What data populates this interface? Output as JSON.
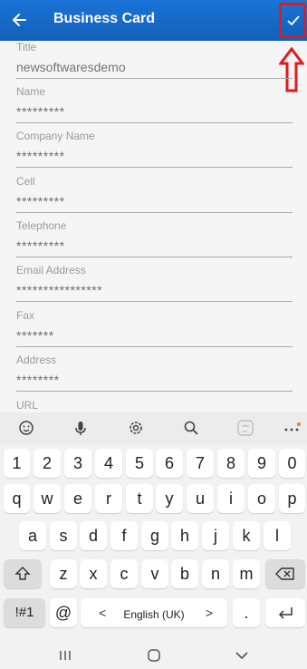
{
  "appbar": {
    "title": "Business Card",
    "back_icon": "arrow-left-icon",
    "save_icon": "check-icon",
    "bg_color": "#1a73d6",
    "annotation_color": "#e01b1b"
  },
  "form": {
    "fields": [
      {
        "label": "Title",
        "value": "newsoftwaresdemo"
      },
      {
        "label": "Name",
        "value": "*********"
      },
      {
        "label": "Company Name",
        "value": "*********"
      },
      {
        "label": "Cell",
        "value": "*********"
      },
      {
        "label": "Telephone",
        "value": "*********"
      },
      {
        "label": "Email Address",
        "value": "****************"
      },
      {
        "label": "Fax",
        "value": "*******"
      },
      {
        "label": "Address",
        "value": "********"
      },
      {
        "label": "URL",
        "value": ""
      }
    ]
  },
  "keyboard": {
    "toolbar": [
      "emoji-icon",
      "microphone-icon",
      "settings-icon",
      "search-icon",
      "translate-icon",
      "more-icon"
    ],
    "row_numbers": [
      "1",
      "2",
      "3",
      "4",
      "5",
      "6",
      "7",
      "8",
      "9",
      "0"
    ],
    "row1": [
      "q",
      "w",
      "e",
      "r",
      "t",
      "y",
      "u",
      "i",
      "o",
      "p"
    ],
    "row2": [
      "a",
      "s",
      "d",
      "f",
      "g",
      "h",
      "j",
      "k",
      "l"
    ],
    "row3": [
      "z",
      "x",
      "c",
      "v",
      "b",
      "n",
      "m"
    ],
    "symbols_label": "!#1",
    "at_label": "@",
    "space_label": "English (UK)",
    "space_left": "<",
    "space_right": ">",
    "period_label": "."
  },
  "navbar": {
    "items": [
      "recents-icon",
      "home-icon",
      "back-chevron-icon"
    ]
  }
}
